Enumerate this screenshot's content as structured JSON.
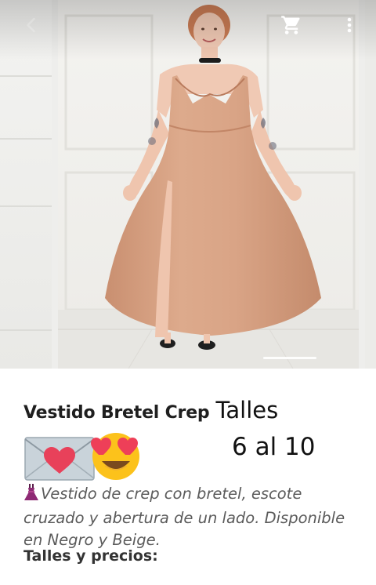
{
  "product": {
    "title": "Vestido Bretel Crep",
    "sizes_label": "Talles",
    "sizes_range": "6 al 10",
    "description": "Vestido de crep con bretel, escote cruzado y abertura de un lado. Disponible en Negro y Beige.",
    "prices_heading": "Talles y precios:"
  },
  "icons": {
    "back": "arrow-back-icon",
    "cart": "shopping-cart-icon",
    "more": "more-vert-icon",
    "dress": "dress-emoji",
    "love_letter": "love-letter-emoji",
    "heart_eyes": "heart-eyes-emoji"
  },
  "carousel": {
    "indicator_active": 1
  },
  "colors": {
    "dress": "#d9a486",
    "text_primary": "#1f1f1f",
    "text_secondary": "#5b5b5b"
  }
}
